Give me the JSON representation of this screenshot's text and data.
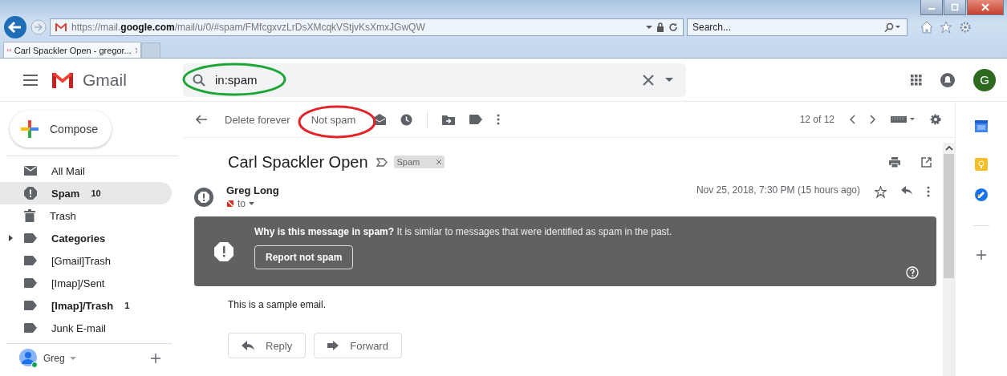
{
  "browser": {
    "url": "https://mail.**google.com**/mail/u/0/#spam/FMfcgxvzLrDsXMcqkVStjvKsXmxJGwQW",
    "search_placeholder": "Search...",
    "tab_title": "Carl Spackler Open - gregor..."
  },
  "header": {
    "app_name": "Gmail",
    "search_value": "in:spam",
    "avatar_letter": "G"
  },
  "toolbar": {
    "actions": [
      "Delete forever",
      "Not spam"
    ],
    "counter": "12 of 12"
  },
  "sidebar": {
    "compose": "Compose",
    "items": [
      {
        "label": "All Mail",
        "kind": "mail",
        "unread": false,
        "selected": false,
        "has_children": false
      },
      {
        "label": "Spam",
        "count": "10",
        "kind": "spam",
        "unread": true,
        "selected": true,
        "has_children": false
      },
      {
        "label": "Trash",
        "kind": "trash",
        "unread": false,
        "selected": false,
        "has_children": false
      },
      {
        "label": "Categories",
        "kind": "label",
        "unread": true,
        "selected": false,
        "has_children": true
      },
      {
        "label": "[Gmail]Trash",
        "kind": "label",
        "unread": false,
        "selected": false,
        "has_children": false
      },
      {
        "label": "[Imap]/Sent",
        "kind": "label",
        "unread": false,
        "selected": false,
        "has_children": false
      },
      {
        "label": "[Imap]/Trash",
        "count": "1",
        "kind": "label",
        "unread": true,
        "selected": false,
        "has_children": false
      },
      {
        "label": "Junk E-mail",
        "kind": "label",
        "unread": false,
        "selected": false,
        "has_children": false
      }
    ],
    "account": "Greg"
  },
  "message": {
    "subject": "Carl Spackler Open",
    "tag": "Spam",
    "sender": "Greg Long",
    "recipient": "to",
    "date": "Nov 25, 2018, 7:30 PM (15 hours ago)",
    "starred": false,
    "warning": {
      "text": "**Why is this message in spam?** It is similar to messages that were identified as spam in the past.",
      "button": "Report not spam"
    },
    "body": "This is a sample email.",
    "replies": [
      "Reply",
      "Forward"
    ]
  }
}
